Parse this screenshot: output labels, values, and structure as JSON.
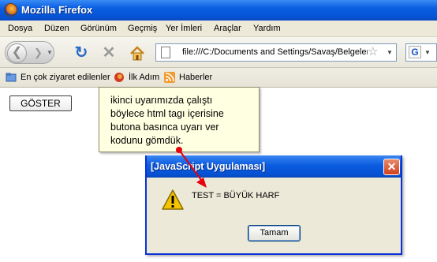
{
  "window": {
    "title": "Mozilla Firefox"
  },
  "menubar": {
    "items": [
      {
        "label": "Dosya"
      },
      {
        "label": "Düzen"
      },
      {
        "label": "Görünüm"
      },
      {
        "label": "Geçmiş"
      },
      {
        "label": "Yer İmleri"
      },
      {
        "label": "Araçlar"
      },
      {
        "label": "Yardım"
      }
    ]
  },
  "navbar": {
    "url": "file:///C:/Documents and Settings/Savaş/Belgeler"
  },
  "bookmarks": {
    "items": [
      {
        "label": "En çok ziyaret edilenler",
        "icon": "bookmarks-folder-icon"
      },
      {
        "label": "İlk Adım",
        "icon": "firefox-start-icon"
      },
      {
        "label": "Haberler",
        "icon": "rss-icon"
      }
    ]
  },
  "page": {
    "button_label": "GÖSTER"
  },
  "tooltip": {
    "lines": [
      "ikinci uyarımızda çalıştı",
      "böylece html tagı içerisine",
      "butona basınca uyarı ver",
      "kodunu gömdük."
    ]
  },
  "dialog": {
    "title": "[JavaScript Uygulaması]",
    "message": "TEST = BÜYÜK HARF",
    "ok_label": "Tamam"
  },
  "colors": {
    "titlebar": "#0a5ee0",
    "tooltip_bg": "#ffffe1",
    "annotation": "#e8000b",
    "xp_face": "#ece9d8"
  }
}
